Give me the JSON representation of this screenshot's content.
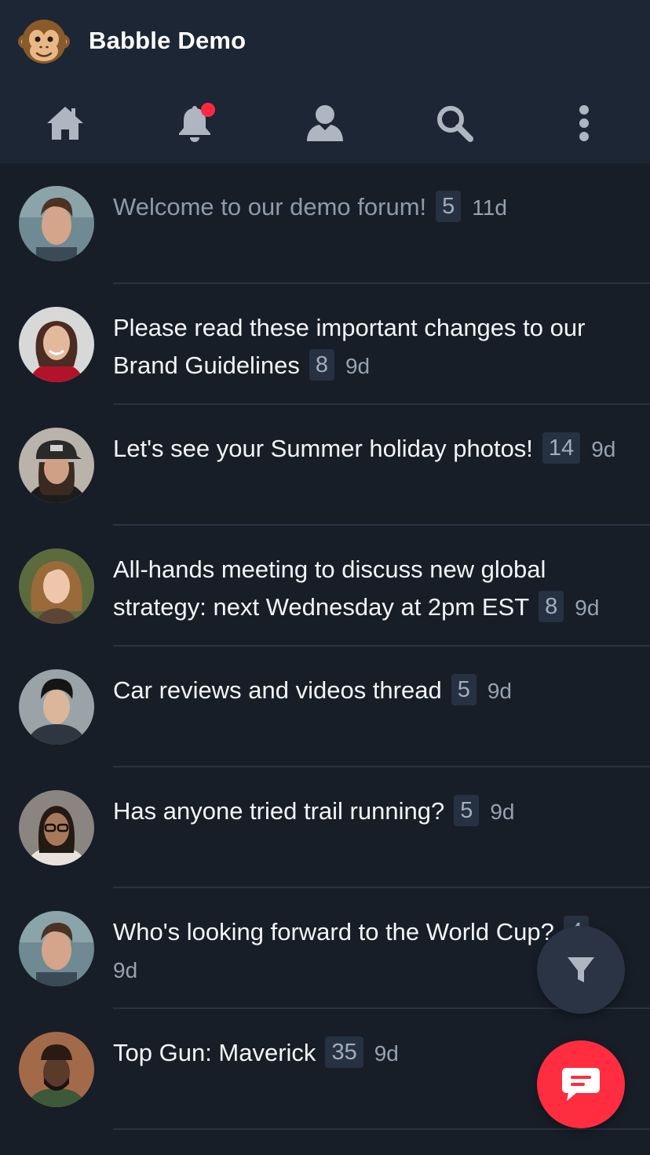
{
  "app": {
    "title": "Babble Demo",
    "logo_icon": "monkey-icon"
  },
  "nav": [
    {
      "name": "home",
      "icon": "home-icon"
    },
    {
      "name": "notifications",
      "icon": "bell-icon",
      "has_unread": true
    },
    {
      "name": "profile",
      "icon": "user-icon"
    },
    {
      "name": "search",
      "icon": "search-icon"
    },
    {
      "name": "more",
      "icon": "more-vertical-icon"
    }
  ],
  "topics": [
    {
      "title": "Welcome to our demo forum!",
      "replies": "5",
      "age": "11d",
      "read": true
    },
    {
      "title": "Please read these important changes to our Brand Guidelines",
      "replies": "8",
      "age": "9d",
      "read": false
    },
    {
      "title": "Let's see your Summer holiday photos!",
      "replies": "14",
      "age": "9d",
      "read": false
    },
    {
      "title": "All-hands meeting to discuss new global strategy: next Wednesday at 2pm EST",
      "replies": "8",
      "age": "9d",
      "read": false
    },
    {
      "title": "Car reviews and videos thread",
      "replies": "5",
      "age": "9d",
      "read": false
    },
    {
      "title": "Has anyone tried trail running?",
      "replies": "5",
      "age": "9d",
      "read": false
    },
    {
      "title": "Who's looking forward to the World Cup?",
      "replies": "4",
      "age": "9d",
      "read": false
    },
    {
      "title": "Top Gun: Maverick",
      "replies": "35",
      "age": "9d",
      "read": false
    }
  ],
  "fab": {
    "filter_icon": "filter-icon",
    "new_topic_icon": "chat-icon"
  },
  "colors": {
    "header_bg": "#1d2634",
    "body_bg": "#171e28",
    "accent": "#ff2d3f",
    "badge_bg": "#263141"
  }
}
